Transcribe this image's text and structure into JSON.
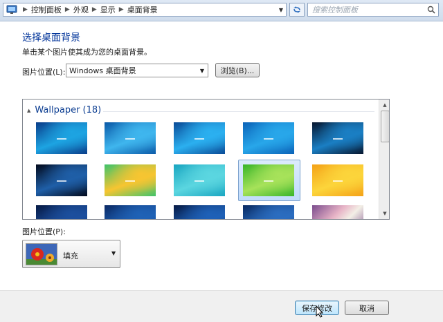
{
  "address_bar": {
    "crumbs": [
      "控制面板",
      "外观",
      "显示",
      "桌面背景"
    ]
  },
  "search": {
    "placeholder": "搜索控制面板"
  },
  "heading": {
    "title": "选择桌面背景",
    "subtitle": "单击某个图片使其成为您的桌面背景。"
  },
  "picture_location": {
    "label": "图片位置(L):",
    "value": "Windows 桌面背景",
    "browse_label": "浏览(B)..."
  },
  "wallpaper_list": {
    "group_title": "Wallpaper (18)",
    "selected_index": 8,
    "thumbnails": [
      {
        "name": "wallpaper-1",
        "colors": [
          "#0a3d8a",
          "#1da4e2"
        ]
      },
      {
        "name": "wallpaper-2",
        "colors": [
          "#0b5aa8",
          "#3fb6ee"
        ]
      },
      {
        "name": "wallpaper-3",
        "colors": [
          "#0a4b97",
          "#2bb0f0"
        ]
      },
      {
        "name": "wallpaper-4",
        "colors": [
          "#0b63b8",
          "#28a7ea"
        ]
      },
      {
        "name": "wallpaper-5",
        "colors": [
          "#07162e",
          "#1a7fc4"
        ]
      },
      {
        "name": "wallpaper-6",
        "colors": [
          "#020a1c",
          "#1f5fa8"
        ]
      },
      {
        "name": "wallpaper-7",
        "colors": [
          "#3fc36b",
          "#f7c531"
        ]
      },
      {
        "name": "wallpaper-8",
        "colors": [
          "#1aa6c1",
          "#5bd6e0"
        ]
      },
      {
        "name": "wallpaper-9",
        "colors": [
          "#39b52a",
          "#a7e25a"
        ]
      },
      {
        "name": "wallpaper-10",
        "colors": [
          "#f4a218",
          "#fcd53b"
        ]
      },
      {
        "name": "wallpaper-11",
        "colors": [
          "#061a45",
          "#1c4f9e"
        ]
      },
      {
        "name": "wallpaper-12",
        "colors": [
          "#0b2a66",
          "#1f62b6"
        ]
      },
      {
        "name": "wallpaper-13",
        "colors": [
          "#061a45",
          "#1e61b8"
        ]
      },
      {
        "name": "wallpaper-14",
        "colors": [
          "#092a62",
          "#2b6dc0"
        ]
      },
      {
        "name": "wallpaper-15",
        "colors": [
          "#7a4b8c",
          "#e7b3c6"
        ]
      }
    ]
  },
  "picture_position": {
    "label": "图片位置(P):",
    "value": "填充"
  },
  "buttons": {
    "save": "保存修改",
    "cancel": "取消"
  },
  "colors": {
    "title_blue": "#003399",
    "selection": "#c1dcfc"
  }
}
